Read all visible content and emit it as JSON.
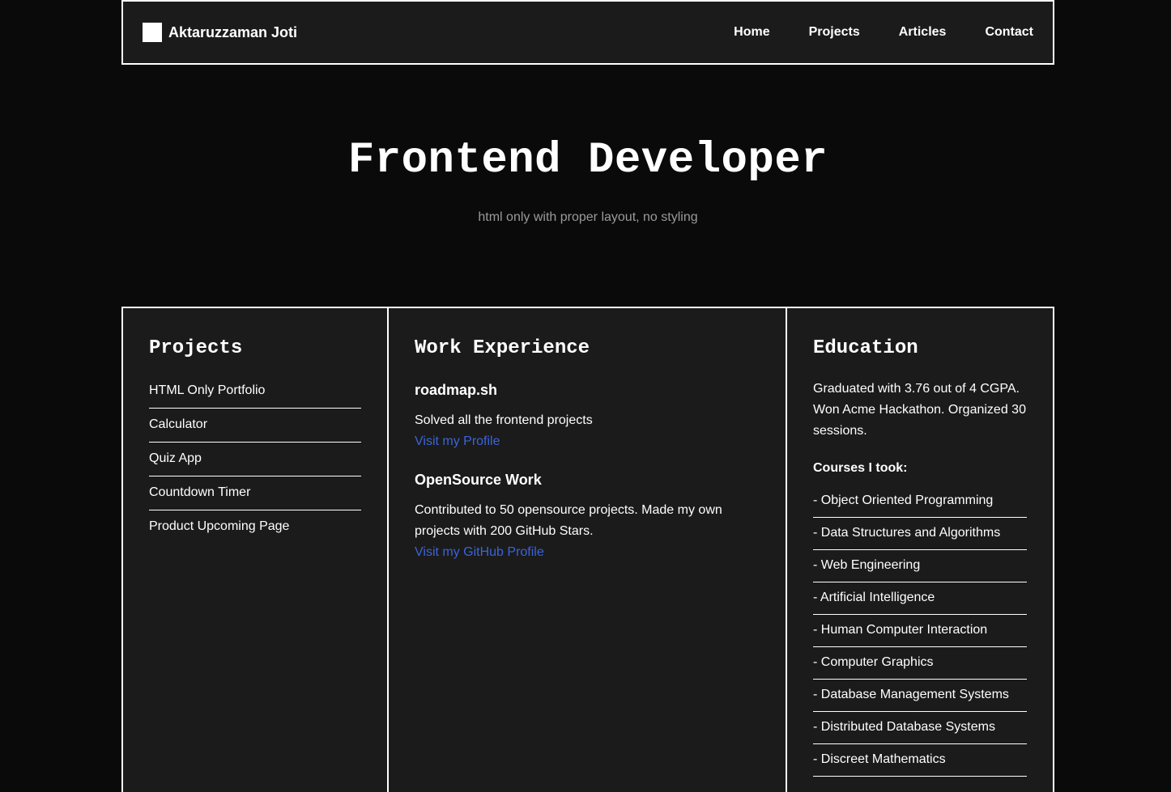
{
  "header": {
    "brand_name": "Aktaruzzaman Joti",
    "nav": [
      "Home",
      "Projects",
      "Articles",
      "Contact"
    ]
  },
  "hero": {
    "title": "Frontend Developer",
    "subtitle": "html only with proper layout, no styling"
  },
  "projects": {
    "title": "Projects",
    "items": [
      "HTML Only Portfolio",
      "Calculator",
      "Quiz App",
      "Countdown Timer",
      "Product Upcoming Page"
    ]
  },
  "work": {
    "title": "Work Experience",
    "entries": [
      {
        "company": "roadmap.sh",
        "description": "Solved all the frontend projects",
        "link": "Visit my Profile"
      },
      {
        "company": "OpenSource Work",
        "description": "Contributed to 50 opensource projects. Made my own projects with 200 GitHub Stars.",
        "link": "Visit my GitHub Profile"
      }
    ]
  },
  "education": {
    "title": "Education",
    "description": "Graduated with 3.76 out of 4 CGPA. Won Acme Hackathon. Organized 30 sessions.",
    "courses_label": "Courses I took:",
    "courses": [
      "- Object Oriented Programming",
      "- Data Structures and Algorithms",
      "- Web Engineering",
      "- Artificial Intelligence",
      "- Human Computer Interaction",
      "- Computer Graphics",
      "- Database Management Systems",
      "- Distributed Database Systems",
      "- Discreet Mathematics"
    ]
  },
  "colors": {
    "background": "#0a0a0a",
    "panel": "#1b1b1b",
    "border": "#ffffff",
    "link": "#3b64d8",
    "subtitle": "#9a9a9a"
  }
}
